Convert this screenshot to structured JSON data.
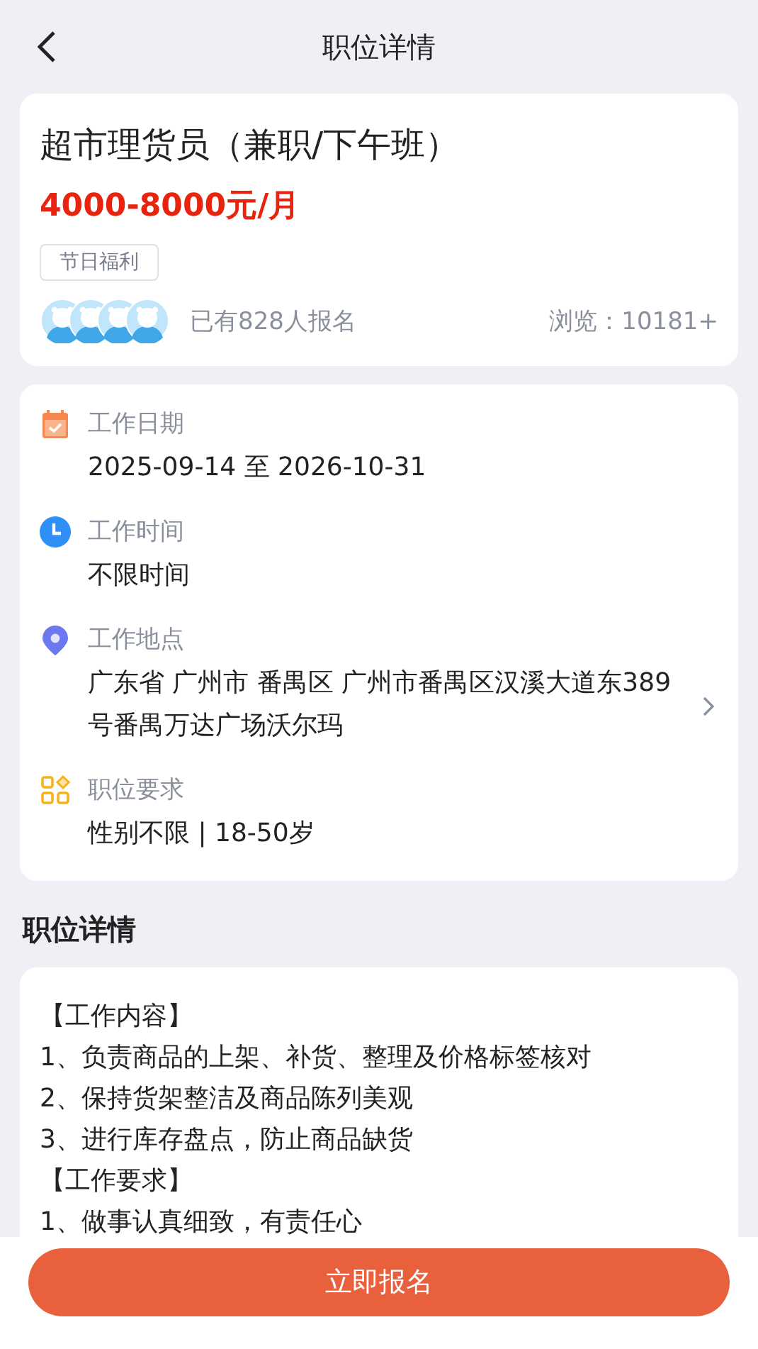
{
  "header": {
    "title": "职位详情"
  },
  "job": {
    "title": "超市理货员（兼职/下午班）",
    "salary": "4000-8000元/月",
    "tags": [
      "节日福利"
    ],
    "applicants": "已有828人报名",
    "views": "浏览：10181+"
  },
  "info": [
    {
      "kind": "calendar",
      "label": "工作日期",
      "value": "2025-09-14 至 2026-10-31",
      "navigable": false
    },
    {
      "kind": "clock",
      "label": "工作时间",
      "value": "不限时间",
      "navigable": false
    },
    {
      "kind": "location",
      "label": "工作地点",
      "value": "广东省 广州市 番禺区 广州市番禺区汉溪大道东389号番禺万达广场沃尔玛",
      "navigable": true
    },
    {
      "kind": "requirements",
      "label": "职位要求",
      "value": "性别不限 | 18-50岁",
      "navigable": false
    }
  ],
  "details": {
    "heading": "职位详情",
    "lines": [
      "【工作内容】",
      "1、负责商品的上架、补货、整理及价格标签核对",
      "2、保持货架整洁及商品陈列美观",
      "3、进行库存盘点，防止商品缺货",
      "【工作要求】",
      "1、做事认真细致，有责任心"
    ]
  },
  "action": {
    "label": "立即报名"
  }
}
